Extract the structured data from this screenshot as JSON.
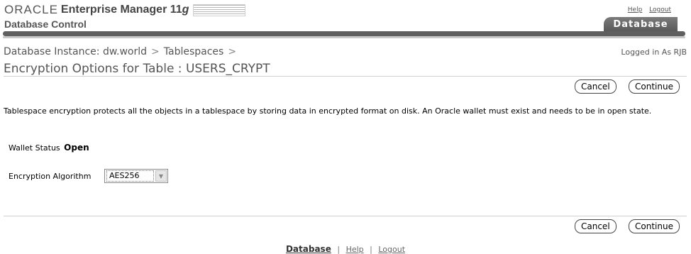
{
  "header": {
    "oracle_logo": "ORACLE",
    "product_name": "Enterprise Manager 11",
    "product_version_g": "g",
    "product_sub": "Database Control",
    "global_links": {
      "help": "Help",
      "logout": "Logout"
    },
    "active_tab": "Database"
  },
  "breadcrumb": {
    "items": [
      "Database Instance: dw.world",
      "Tablespaces"
    ],
    "separator": ">"
  },
  "user_info": "Logged in As RJB",
  "page_title": "Encryption Options for Table : USERS_CRYPT",
  "buttons": {
    "cancel": "Cancel",
    "continue": "Continue"
  },
  "description": "Tablespace encryption protects all the objects in a tablespace by storing data in encrypted format on disk. An Oracle wallet must exist and needs to be in open state.",
  "wallet": {
    "label": "Wallet Status",
    "value": "Open"
  },
  "algorithm": {
    "label": "Encryption Algorithm",
    "selected": "AES256"
  },
  "footer": {
    "database": "Database",
    "help": "Help",
    "logout": "Logout",
    "separator": "|"
  }
}
